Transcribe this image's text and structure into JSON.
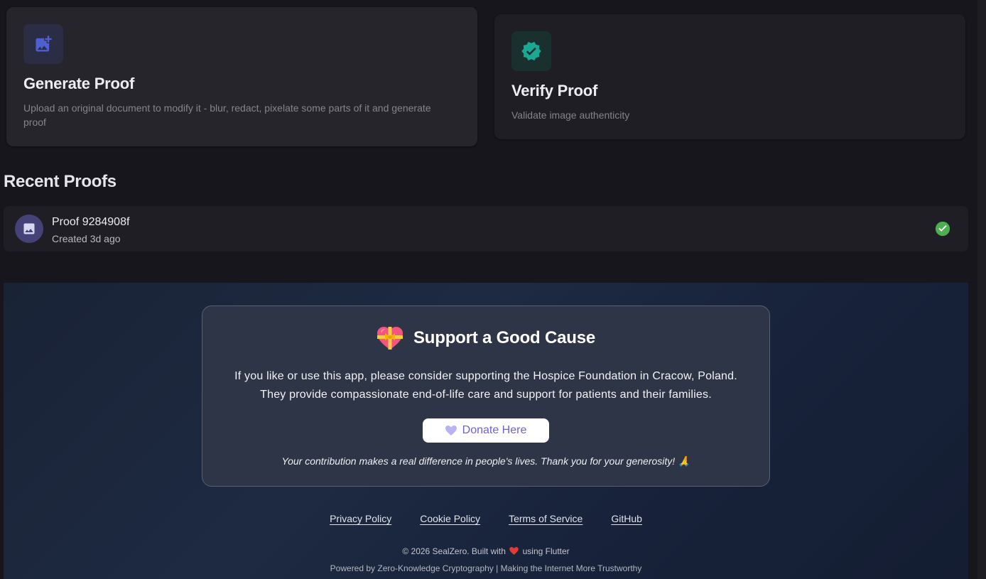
{
  "actions": {
    "generate": {
      "icon": "add-photo-icon",
      "title": "Generate Proof",
      "description": "Upload an original document to modify it - blur, redact, pixelate some parts of it and generate proof"
    },
    "verify": {
      "icon": "verified-badge-icon",
      "title": "Verify Proof",
      "description": "Validate image authenticity"
    }
  },
  "recent": {
    "title": "Recent Proofs",
    "items": [
      {
        "icon": "image-icon",
        "name": "Proof 9284908f",
        "created": "Created 3d ago",
        "status_icon": "check-circle-icon"
      }
    ]
  },
  "support": {
    "icon": "heart-with-ribbon-icon",
    "title": "Support a Good Cause",
    "text_line1": "If you like or use this app, please consider supporting the Hospice Foundation in Cracow, Poland.",
    "text_line2": "They provide compassionate end-of-life care and support for patients and their families.",
    "donate_label": "Donate Here",
    "donate_icon": "heart-icon",
    "note": "Your contribution makes a real difference in people's lives. Thank you for your generosity! 🙏"
  },
  "footer": {
    "links": [
      "Privacy Policy",
      "Cookie Policy",
      "Terms of Service",
      "GitHub"
    ],
    "copyright_prefix": "© 2026 SealZero. Built with",
    "copyright_suffix": "using Flutter",
    "powered": "Powered by Zero-Knowledge Cryptography | Making the Internet More Trustworthy"
  },
  "colors": {
    "accent_indigo": "#6a63d9",
    "verify_teal": "#1aa892",
    "success_green": "#4caf50",
    "heart_red": "#e53935"
  }
}
